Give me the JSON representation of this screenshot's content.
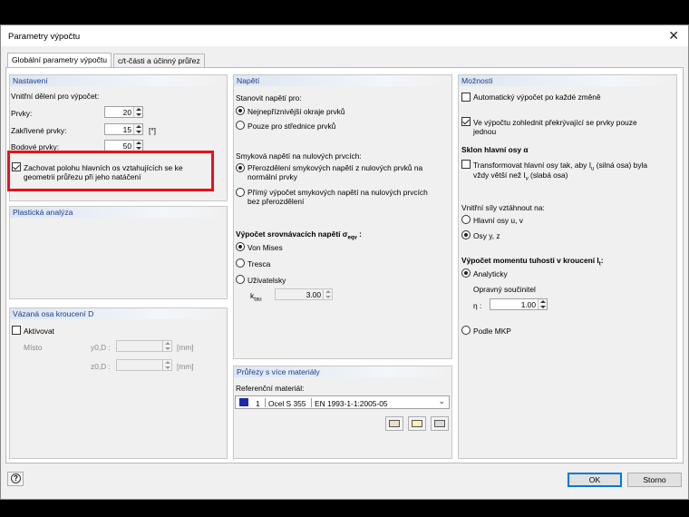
{
  "window": {
    "title": "Parametry výpočtu",
    "close_glyph": "✕"
  },
  "tabs": [
    "Globální parametry výpočtu",
    "c/t-části a účinný průřez"
  ],
  "nastaveni": {
    "header": "Nastavení",
    "division_label": "Vnitřní dělení pro výpočet:",
    "rows": [
      {
        "label": "Prvky:",
        "value": "20"
      },
      {
        "label": "Zakřivené prvky:",
        "value": "15",
        "unit": "[°]"
      },
      {
        "label": "Bodové prvky:",
        "value": "50"
      }
    ],
    "keep_axes_checkbox": {
      "checked": true,
      "label_line1": "Zachovat polohu hlavních os vztahujících se ke",
      "label_line2": "geometrii průřezu při jeho natáčení"
    }
  },
  "plasticka": {
    "header": "Plastická analýza"
  },
  "vazana": {
    "header": "Vázaná osa kroucení D",
    "aktivovat": {
      "checked": false,
      "label": "Aktivovat"
    },
    "misto_label": "Místo",
    "y_label": "y0,D :",
    "z_label": "z0,D :",
    "unit": "[mm]"
  },
  "napeti": {
    "header": "Napětí",
    "stanovit_label": "Stanovit napětí pro:",
    "stanovit_options": [
      {
        "label": "Nejnepříznivější okraje prvků",
        "selected": true
      },
      {
        "label": "Pouze pro střednice prvků",
        "selected": false
      }
    ],
    "smykova_label": "Smyková napětí na nulových prvcích:",
    "smykova_options": [
      {
        "line1": "Přerozdělení smykových napětí z nulových prvků na",
        "line2": "normální prvky",
        "selected": true
      },
      {
        "line1": "Přímý výpočet smykových napětí na nulových prvcích",
        "line2": "bez přerozdělení",
        "selected": false
      }
    ],
    "srovnavaci_label": "Výpočet srovnávacích napětí σ",
    "srovnavaci_sub": "eqv",
    "srovnavaci_suffix": " :",
    "srovnavaci_options": [
      {
        "label": "Von Mises",
        "selected": true
      },
      {
        "label": "Tresca",
        "selected": false
      },
      {
        "label": "Uživatelsky",
        "selected": false
      }
    ],
    "ktau_label": "k",
    "ktau_sub": "tau",
    "ktau_value": "3.00"
  },
  "prurezy": {
    "header": "Průřezy s více materiály",
    "ref_label": "Referenční materiál:",
    "combo": {
      "color": "#1c2aa8",
      "num": "1",
      "name": "Ocel S 355",
      "norm": "EN 1993-1-1:2005-05"
    },
    "icons": [
      "library-icon",
      "new-material-icon",
      "import-icon"
    ]
  },
  "moznosti": {
    "header": "Možnosti",
    "auto_calc": {
      "checked": false,
      "label": "Automatický výpočet po každé změně"
    },
    "overlap": {
      "checked": true,
      "line1": "Ve výpočtu zohlednit překrývající se prvky pouze",
      "line2": "jednou"
    },
    "sklon_label": "Sklon hlavní osy α",
    "transform": {
      "checked": false,
      "line1": "Transformovat hlavní osy tak, aby I",
      "line1_sub": "u",
      "line1_rest": " (silná osa) byla",
      "line2": "vždy větší než I",
      "line2_sub": "v",
      "line2_rest": " (slabá  osa)"
    },
    "vnitrni_label": "Vnitřní síly vztáhnout na:",
    "vnitrni_options": [
      {
        "label": "Hlavní osy u, v",
        "selected": false
      },
      {
        "label": "Osy y, z",
        "selected": true
      }
    ],
    "moment_label": "Výpočet momentu tuhosti v kroucení I",
    "moment_sub": "t",
    "moment_suffix": ":",
    "moment_options": [
      {
        "label": "Analyticky",
        "selected": true
      },
      {
        "label": "Podle MKP",
        "selected": false
      }
    ],
    "korekce_label": "Opravný součinitel",
    "eta_label": "η :",
    "eta_value": "1.00"
  },
  "footer": {
    "ok": "OK",
    "cancel": "Storno"
  }
}
